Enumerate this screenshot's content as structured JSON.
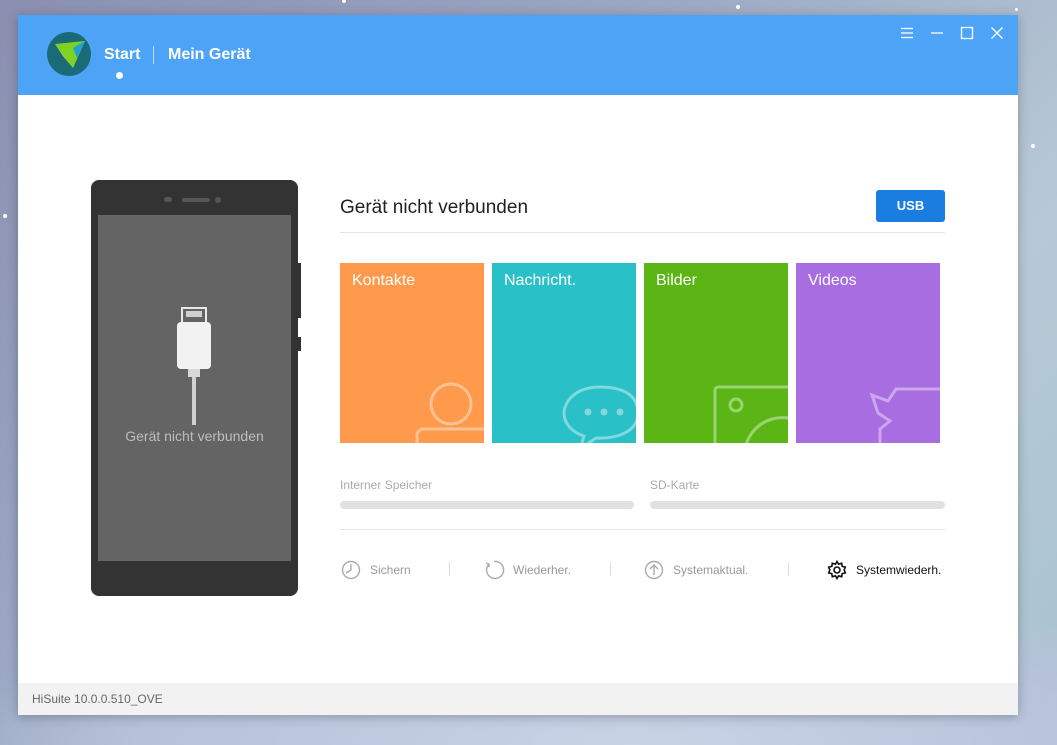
{
  "nav": {
    "start": "Start",
    "device": "Mein Gerät"
  },
  "phone": {
    "screen_message": "Gerät nicht verbunden"
  },
  "status": {
    "title": "Gerät nicht verbunden",
    "usb_button": "USB"
  },
  "tiles": [
    {
      "label": "Kontakte",
      "color": "#ff9a4c",
      "icon": "contact-icon"
    },
    {
      "label": "Nachricht.",
      "color": "#2ac0c8",
      "icon": "message-icon"
    },
    {
      "label": "Bilder",
      "color": "#5bb615",
      "icon": "picture-icon"
    },
    {
      "label": "Videos",
      "color": "#a86de0",
      "icon": "video-icon"
    }
  ],
  "storage": {
    "internal_label": "Interner Speicher",
    "sd_label": "SD-Karte"
  },
  "actions": [
    {
      "label": "Sichern",
      "icon": "backup-icon"
    },
    {
      "label": "Wiederher.",
      "icon": "restore-icon"
    },
    {
      "label": "Systemaktual.",
      "icon": "update-icon"
    },
    {
      "label": "Systemwiederh.",
      "icon": "gear-icon"
    }
  ],
  "footer": {
    "version": "HiSuite 10.0.0.510_OVE"
  },
  "colors": {
    "titlebar": "#4da4f7",
    "accent": "#1a7de0"
  }
}
